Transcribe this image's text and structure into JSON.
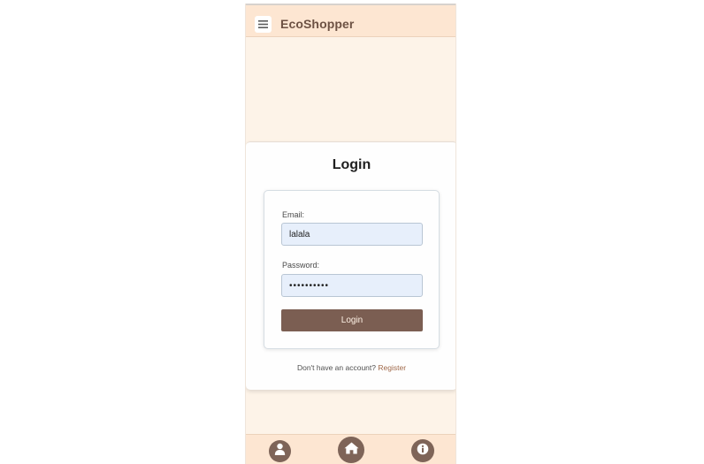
{
  "header": {
    "app_title": "EcoShopper",
    "menu_icon": "menu-icon"
  },
  "login": {
    "title": "Login",
    "email_label": "Email:",
    "email_value": "lalala",
    "password_label": "Password:",
    "password_value": "••••••••••",
    "submit_label": "Login",
    "register_prompt": "Don't have an account?",
    "register_link": "Register"
  },
  "bottom_nav": {
    "items": [
      {
        "icon": "user-icon"
      },
      {
        "icon": "home-icon"
      },
      {
        "icon": "info-icon"
      }
    ]
  },
  "colors": {
    "header_bg": "#fde6d2",
    "page_bg": "#fdf3e8",
    "accent_brown": "#7b5e52",
    "link": "#a0694a",
    "input_bg": "#e7effb"
  }
}
